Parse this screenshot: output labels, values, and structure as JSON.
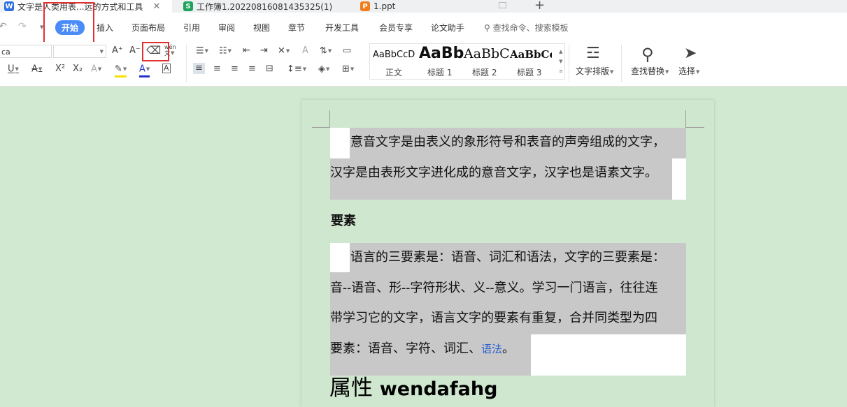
{
  "tabs": [
    {
      "icon": "W",
      "label": "文字是人类用表...远的方式和工具",
      "close": "✕"
    },
    {
      "icon": "S",
      "label": "工作簿1.20220816081435325(1)"
    },
    {
      "icon": "P",
      "label": "1.ppt"
    }
  ],
  "new_tab": "+",
  "menu": {
    "items": [
      "开始",
      "插入",
      "页面布局",
      "引用",
      "审阅",
      "视图",
      "章节",
      "开发工具",
      "会员专享",
      "论文助手"
    ],
    "search_placeholder": "查找命令、搜索模板"
  },
  "ribbon": {
    "font_name": "ca",
    "font_size": "",
    "styles": [
      {
        "preview": "AaBbCcD",
        "label": "正文"
      },
      {
        "preview": "AaBb",
        "label": "标题 1"
      },
      {
        "preview": "AaBbC",
        "label": "标题 2"
      },
      {
        "preview": "AaBbCcI",
        "label": "标题 3"
      }
    ],
    "big_buttons": [
      "文字排版",
      "查找替换",
      "选择"
    ],
    "wen_label": "wén"
  },
  "document": {
    "para1": [
      "意音文字是由表义的象形符号和表音的声旁组成的文字，",
      "汉字是由表形文字进化成的意音文字，汉字也是语素文字。"
    ],
    "heading": "要素",
    "para2": [
      "语言的三要素是：语音、词汇和语法，文字的三要素是：",
      "音--语音、形--字符形状、义--意义。学习一门语言，往往连",
      "带学习它的文字，语言文字的要素有重复，合并同类型为四",
      "要素：语音、字符、词汇、"
    ],
    "para2_link": "语法",
    "para2_end": "。",
    "h1_cn": "属性",
    "h1_en": "wendafahg"
  },
  "colors": {
    "accent": "#4a8cf7",
    "highlight_box": "#e03030",
    "page_bg": "#cfe6cf",
    "selection": "#c8c8c8"
  }
}
